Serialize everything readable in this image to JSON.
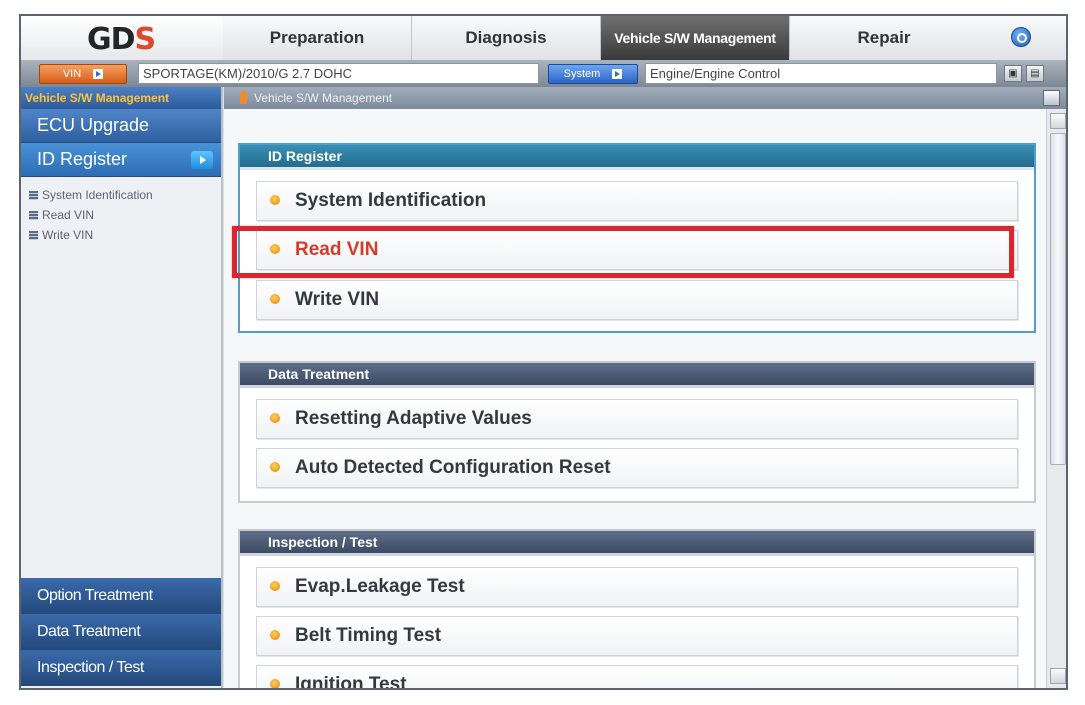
{
  "nav": {
    "logo": "GD",
    "logo_accent": "S",
    "tabs": [
      "Preparation",
      "Diagnosis",
      "Vehicle S/W Management",
      "Repair"
    ],
    "active_tab": "Vehicle S/W Management"
  },
  "infobar": {
    "vin_button": "VIN",
    "vehicle": "SPORTAGE(KM)/2010/G 2.7 DOHC",
    "system_button": "System",
    "system": "Engine/Engine Control"
  },
  "sidebar": {
    "header": "Vehicle S/W Management",
    "items": [
      "ECU Upgrade",
      "ID Register"
    ],
    "active_item": "ID Register",
    "sub_links": [
      "System Identification",
      "Read VIN",
      "Write VIN"
    ],
    "bottom_items": [
      "Option Treatment",
      "Data Treatment",
      "Inspection / Test"
    ]
  },
  "content": {
    "header": "Vehicle S/W Management",
    "groups": [
      {
        "title": "ID Register",
        "items": [
          "System Identification",
          "Read VIN",
          "Write VIN"
        ]
      },
      {
        "title": "Data Treatment",
        "items": [
          "Resetting Adaptive Values",
          "Auto Detected Configuration Reset"
        ]
      },
      {
        "title": "Inspection / Test",
        "items": [
          "Evap.Leakage Test",
          "Belt Timing Test",
          "Ignition Test"
        ]
      }
    ],
    "highlighted_item": "Read VIN"
  },
  "colors": {
    "highlight_border": "#d9262f",
    "highlight_text": "#d83a2a",
    "sidebar_blue": "#2f5f9f",
    "accent_orange": "#d65d17"
  }
}
